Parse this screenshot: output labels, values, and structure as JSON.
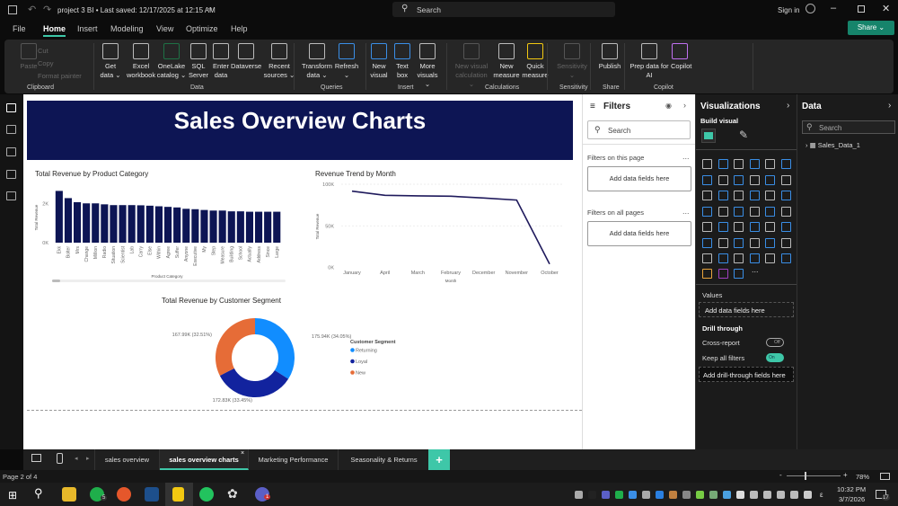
{
  "titlebar": {
    "doc_title": "project 3 BI • Last saved: 12/17/2025 at 12:15 AM",
    "search": "Search",
    "sign_in": "Sign in",
    "share": "Share"
  },
  "menu": [
    "File",
    "Home",
    "Insert",
    "Modeling",
    "View",
    "Optimize",
    "Help"
  ],
  "ribbon": {
    "buttons": [
      {
        "label": "Paste",
        "disabled": true
      },
      {
        "label": "Cut",
        "disabled": true
      },
      {
        "label": "Copy",
        "disabled": true
      },
      {
        "label": "Format painter",
        "disabled": true
      },
      {
        "label": "Get data ⌄"
      },
      {
        "label": "Excel workbook"
      },
      {
        "label": "OneLake catalog ⌄"
      },
      {
        "label": "SQL Server"
      },
      {
        "label": "Enter data"
      },
      {
        "label": "Dataverse"
      },
      {
        "label": "Recent sources ⌄"
      },
      {
        "label": "Transform data ⌄"
      },
      {
        "label": "Refresh ⌄"
      },
      {
        "label": "New visual"
      },
      {
        "label": "Text box"
      },
      {
        "label": "More visuals ⌄"
      },
      {
        "label": "New visual calculation ⌄",
        "disabled": true
      },
      {
        "label": "New measure"
      },
      {
        "label": "Quick measure"
      },
      {
        "label": "Sensitivity ⌄",
        "disabled": true
      },
      {
        "label": "Publish"
      },
      {
        "label": "Prep data for AI"
      },
      {
        "label": "Copilot"
      }
    ],
    "groups": [
      "Clipboard",
      "Data",
      "Queries",
      "Insert",
      "Calculations",
      "Sensitivity",
      "Share",
      "Copilot"
    ]
  },
  "report": {
    "banner": "Sales Overview Charts"
  },
  "chart_data": [
    {
      "type": "bar",
      "title": "Total Revenue by Product Category",
      "xlabel": "Product Category",
      "ylabel": "Total Revenue",
      "ylim": [
        0,
        3000
      ],
      "yticks": [
        "0K",
        "2K"
      ],
      "categories": [
        "Ekk",
        "Bolter",
        "Mrs",
        "Change",
        "Million",
        "Radio",
        "Situation",
        "Scientist",
        "Lab",
        "Carry",
        "Else",
        "Within",
        "Agree",
        "Suffer",
        "Anyone",
        "Executive",
        "My",
        "Step",
        "Measure",
        "Building",
        "School",
        "Actually",
        "Address",
        "Since",
        "Large"
      ],
      "values": [
        2660,
        2290,
        2080,
        2020,
        2020,
        1970,
        1930,
        1930,
        1930,
        1920,
        1900,
        1870,
        1840,
        1810,
        1740,
        1720,
        1680,
        1650,
        1650,
        1610,
        1610,
        1590,
        1590,
        1590,
        1590
      ],
      "color": "#0d1554"
    },
    {
      "type": "line",
      "title": "Revenue Trend by Month",
      "xlabel": "Month",
      "ylabel": "Total Revenue",
      "ylim": [
        0,
        100000
      ],
      "yticks": [
        "0K",
        "50K",
        "100K"
      ],
      "categories": [
        "January",
        "April",
        "March",
        "February",
        "December",
        "November",
        "October"
      ],
      "values": [
        91700,
        86700,
        86000,
        85600,
        83500,
        81000,
        4300
      ],
      "color": "#1f1a5c"
    },
    {
      "type": "pie",
      "title": "Total Revenue by Customer Segment",
      "legend_title": "Customer Segment",
      "legend": "right",
      "slices": [
        {
          "name": "Returning",
          "value": 175.94,
          "label": "175.94K (34.05%)",
          "color": "#118dff"
        },
        {
          "name": "Loyal",
          "value": 172.83,
          "label": "172.83K (33.45%)",
          "color": "#12239e"
        },
        {
          "name": "New",
          "value": 167.99,
          "label": "167.99K (32.51%)",
          "color": "#e66c37"
        }
      ]
    }
  ],
  "filters": {
    "title": "Filters",
    "search": "Search",
    "on_page": "Filters on this page",
    "on_all": "Filters on all pages",
    "add": "Add data fields here",
    "more": "..."
  },
  "viz": {
    "title": "Visualizations",
    "build": "Build visual",
    "values": "Values",
    "add_fields": "Add data fields here",
    "drill": "Drill through",
    "cross": "Cross-report",
    "cross_state": "Off",
    "keep": "Keep all filters",
    "keep_state": "On",
    "add_drill": "Add drill-through fields here",
    "more": "..."
  },
  "data_pane": {
    "title": "Data",
    "search": "Search",
    "table": "Sales_Data_1"
  },
  "tabs": [
    "sales overview",
    "sales overview charts",
    "Marketing Performance",
    "Seasonality & Returns"
  ],
  "status": {
    "page": "Page 2 of 4",
    "zoom": "78%"
  },
  "taskbar": {
    "time": "10:32 PM",
    "date": "3/7/2026",
    "whatsapp_badge": "5",
    "teams_badge": "1",
    "notif": "17",
    "lang": "ε"
  }
}
